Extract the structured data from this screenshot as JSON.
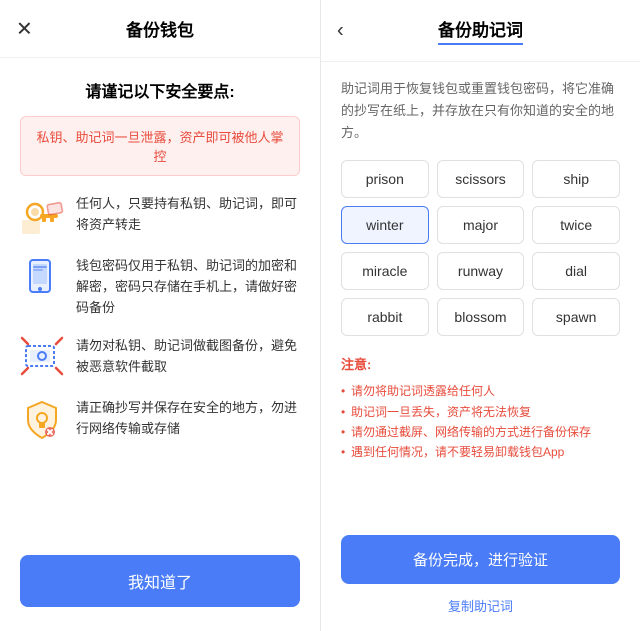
{
  "left": {
    "close_icon": "✕",
    "title": "备份钱包",
    "security_title": "请谨记以下安全要点:",
    "warning": "私钥、助记词一旦泄露，资产即可被他人掌控",
    "items": [
      {
        "icon": "key",
        "text": "任何人，只要持有私钥、助记词，即可将资产转走"
      },
      {
        "icon": "phone",
        "text": "钱包密码仅用于私钥、助记词的加密和解密，密码只存储在手机上，请做好密码备份"
      },
      {
        "icon": "screenshot",
        "text": "请勿对私钥、助记词做截图备份，避免被恶意软件截取"
      },
      {
        "icon": "shield",
        "text": "请正确抄写并保存在安全的地方，勿进行网络传输或存储"
      }
    ],
    "confirm_button": "我知道了"
  },
  "right": {
    "back_icon": "‹",
    "title": "备份助记词",
    "description": "助记词用于恢复钱包或重置钱包密码，将它准确的抄写在纸上，并存放在只有你知道的安全的地方。",
    "words": [
      "prison",
      "scissors",
      "ship",
      "winter",
      "major",
      "twice",
      "miracle",
      "runway",
      "dial",
      "rabbit",
      "blossom",
      "spawn"
    ],
    "highlighted_word": "winter",
    "notice_title": "注意:",
    "notices": [
      "请勿将助记词透露给任何人",
      "助记词一旦丢失，资产将无法恢复",
      "请勿通过截屏、网络传输的方式进行备份保存",
      "遇到任何情况，请不要轻易卸载钱包App"
    ],
    "notice_colors": [
      "normal",
      "normal",
      "red",
      "red"
    ],
    "backup_button": "备份完成，进行验证",
    "copy_link": "复制助记词"
  }
}
